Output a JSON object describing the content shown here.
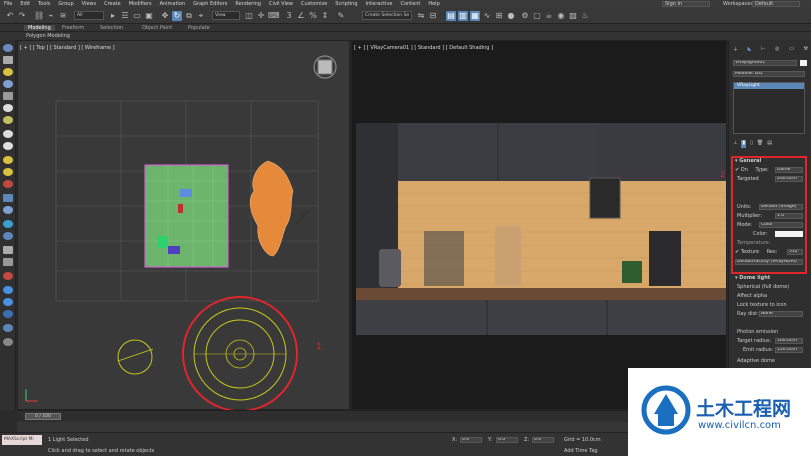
{
  "menu": [
    "File",
    "Edit",
    "Tools",
    "Group",
    "Views",
    "Create",
    "Modifiers",
    "Animation",
    "Graph Editors",
    "Rendering",
    "Civil View",
    "Customize",
    "Scripting",
    "Interactive",
    "Content",
    "Help"
  ],
  "account": {
    "sign_in": "Sign In",
    "workspace_label": "Workspaces:",
    "workspace_value": "Default"
  },
  "toolbar": {
    "filter": "All",
    "coord": "View",
    "selection_set": "Create Selection Se"
  },
  "ribbon": {
    "tabs": [
      "Modeling",
      "Freeform",
      "Selection",
      "Object Paint",
      "Populate"
    ],
    "active": "Modeling",
    "sub_label": "Polygon Modeling"
  },
  "viewport_top": {
    "label": "[ + ] [ Top ] [ Standard ] [ Wireframe ]",
    "annotation": "1"
  },
  "viewport_camera": {
    "label": "[ + ] [ VRayCamera01 ] [ Standard ] [ Default Shading ]"
  },
  "command_panel": {
    "object_name": "VRaylight001",
    "modifier_list": "Modifier List",
    "stack_item": "VRayLight",
    "rollout_general": "General",
    "annotation": "2",
    "on_label": "On",
    "type_label": "Type:",
    "type_value": "Dome",
    "targeted": "Targeted",
    "target_dist": "200.0cm",
    "units_label": "Units:",
    "units_value": "Default (image)",
    "multiplier_label": "Multiplier:",
    "multiplier_value": "1.0",
    "mode_label": "Mode:",
    "mode_value": "Color",
    "color_label": "Color:",
    "temperature_label": "Temperature:",
    "texture_label": "Texture",
    "res_label": "Res:",
    "res_value": "512",
    "texture_map": "DefaultFacility (VRayHDRI)",
    "rollout_dome": "Dome light",
    "spherical": "Spherical (full dome)",
    "affect_alpha": "Affect alpha",
    "lock_texture": "Lock texture to icon",
    "ray_dist_label": "Ray dist:",
    "ray_dist_value": "None",
    "photon_emission": "Photon emission",
    "target_radius_label": "Target radius:",
    "target_radius_value": "100.0cm",
    "emit_radius_label": "Emit radius:",
    "emit_radius_value": "150.0cm",
    "adaptive_dome": "Adaptive dome"
  },
  "timeline": {
    "frame": "0 / 100"
  },
  "status": {
    "maxscript": "MAXScript Mi",
    "selected": "1 Light Selected",
    "prompt": "Click and drag to select and rotate objects",
    "x_label": "X:",
    "x_value": "0.0",
    "y_label": "Y:",
    "y_value": "0.0",
    "z_label": "Z:",
    "z_value": "0.0",
    "grid": "Grid = 10.0cm",
    "add_time_tag": "Add Time Tag"
  },
  "watermark": {
    "title": "土木工程网",
    "url": "www.civilcn.com"
  },
  "colors": {
    "accent": "#5b88b8",
    "annotation": "#e0262b",
    "light_gizmo": "#c9c919",
    "mesh": "#e58a3a",
    "wall": "#d7a869",
    "cabinet": "#3a3a40"
  }
}
